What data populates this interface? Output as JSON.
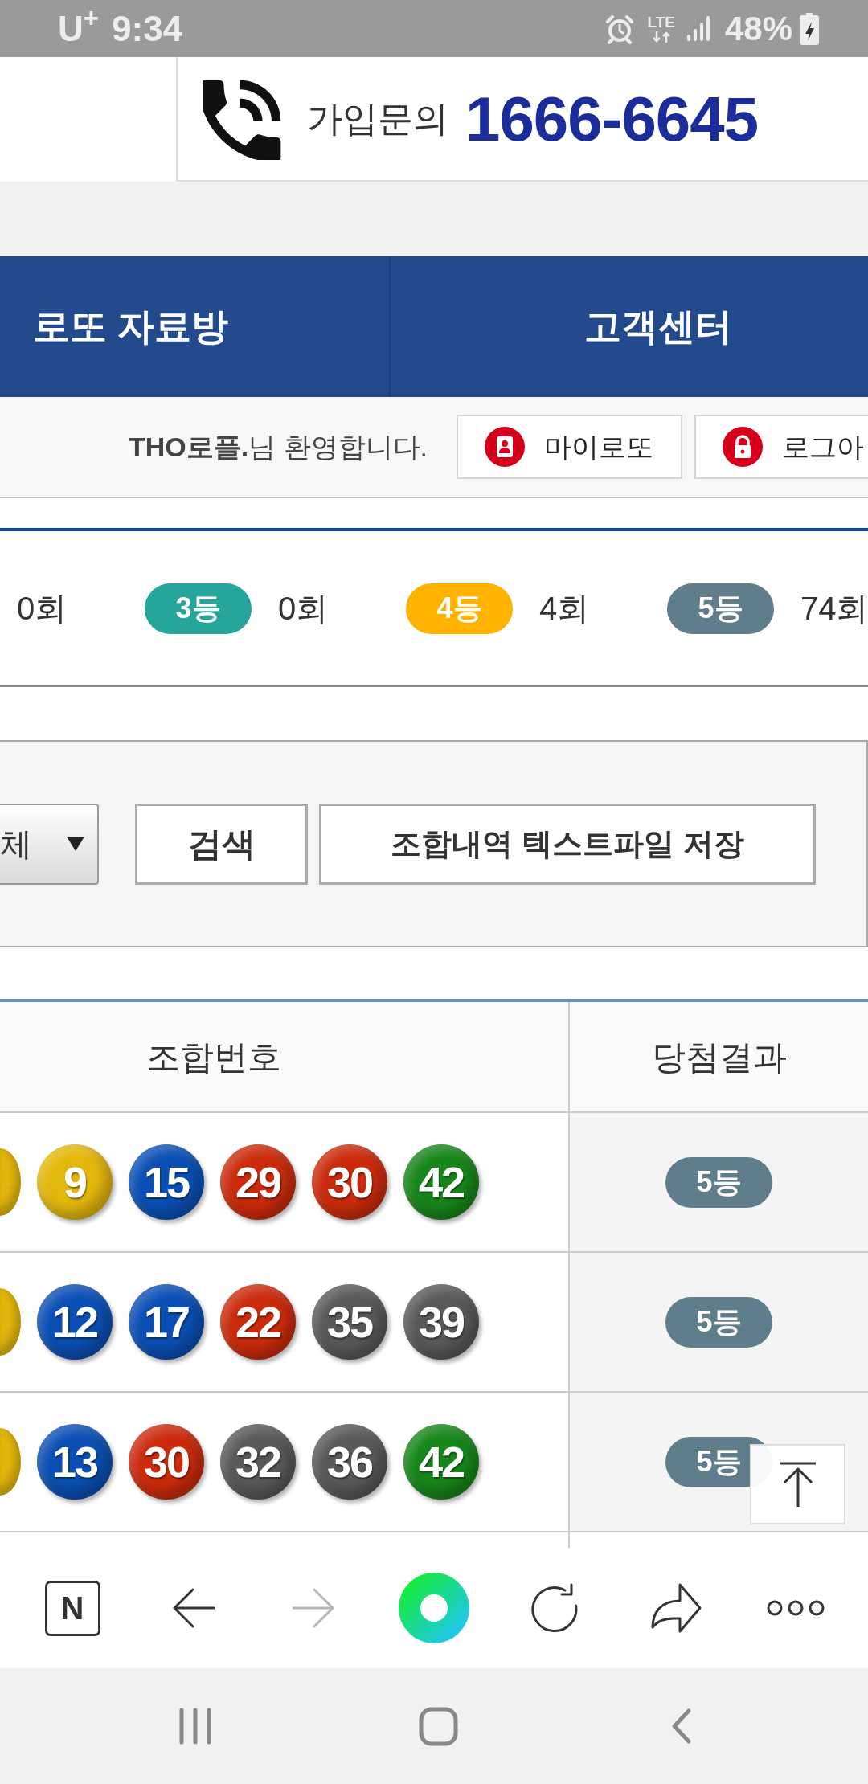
{
  "status_bar": {
    "carrier": "U$^{+}$",
    "time": "9:34",
    "network": "LTE",
    "battery": "48%"
  },
  "header": {
    "label": "가입문의",
    "phone": "1666-6645"
  },
  "nav": [
    {
      "label": "로또 자료방"
    },
    {
      "label": "고객센터"
    }
  ],
  "welcome": {
    "text": "**THO로플.**님 환영합니다.",
    "buttons": [
      {
        "kind": "mylotto",
        "label": "마이로또"
      },
      {
        "kind": "logout",
        "label": "로그아"
      }
    ]
  },
  "grades": [
    {
      "count": "0회"
    },
    {
      "label": "3등",
      "color": "#26a69a",
      "count": "0회"
    },
    {
      "label": "4등",
      "color": "#ffb300",
      "count": "4회"
    },
    {
      "label": "5등",
      "color": "#607d8b",
      "count": "74회"
    }
  ],
  "search": {
    "select_value": "체",
    "buttons": [
      "검색",
      "조합내역 텍스트파일 저장"
    ]
  },
  "table": {
    "columns": [
      "조합번호",
      "당첨결과"
    ],
    "rows": [
      {
        "cut_ball": {
          "color": "#e3b80d"
        },
        "balls": [
          {
            "number": "9",
            "color": "#e3b80d"
          },
          {
            "number": "15",
            "color": "#0b4fb4"
          },
          {
            "number": "29",
            "color": "#cb2b0c"
          },
          {
            "number": "30",
            "color": "#cb2b0c"
          },
          {
            "number": "42",
            "color": "#17861a"
          }
        ],
        "result": {
          "label": "5등",
          "color": "#607d8b"
        }
      },
      {
        "cut_ball": {
          "color": "#e3b80d"
        },
        "balls": [
          {
            "number": "12",
            "color": "#0b4fb4"
          },
          {
            "number": "17",
            "color": "#0b4fb4"
          },
          {
            "number": "22",
            "color": "#cb2b0c"
          },
          {
            "number": "35",
            "color": "#595959"
          },
          {
            "number": "39",
            "color": "#595959"
          }
        ],
        "result": {
          "label": "5등",
          "color": "#607d8b"
        }
      },
      {
        "cut_ball": {
          "color": "#e3b80d"
        },
        "balls": [
          {
            "number": "13",
            "color": "#0b4fb4"
          },
          {
            "number": "30",
            "color": "#cb2b0c"
          },
          {
            "number": "32",
            "color": "#595959"
          },
          {
            "number": "36",
            "color": "#595959"
          },
          {
            "number": "42",
            "color": "#17861a"
          }
        ],
        "result": {
          "label": "5등",
          "color": "#607d8b"
        }
      }
    ]
  },
  "browser_toolbar": [
    {
      "kind": "tabs",
      "label": "N",
      "disabled": false
    },
    {
      "kind": "back",
      "disabled": false
    },
    {
      "kind": "forward",
      "disabled": true
    },
    {
      "kind": "ring",
      "disabled": false
    },
    {
      "kind": "reload",
      "disabled": false
    },
    {
      "kind": "share",
      "disabled": false
    },
    {
      "kind": "more",
      "disabled": false
    }
  ]
}
